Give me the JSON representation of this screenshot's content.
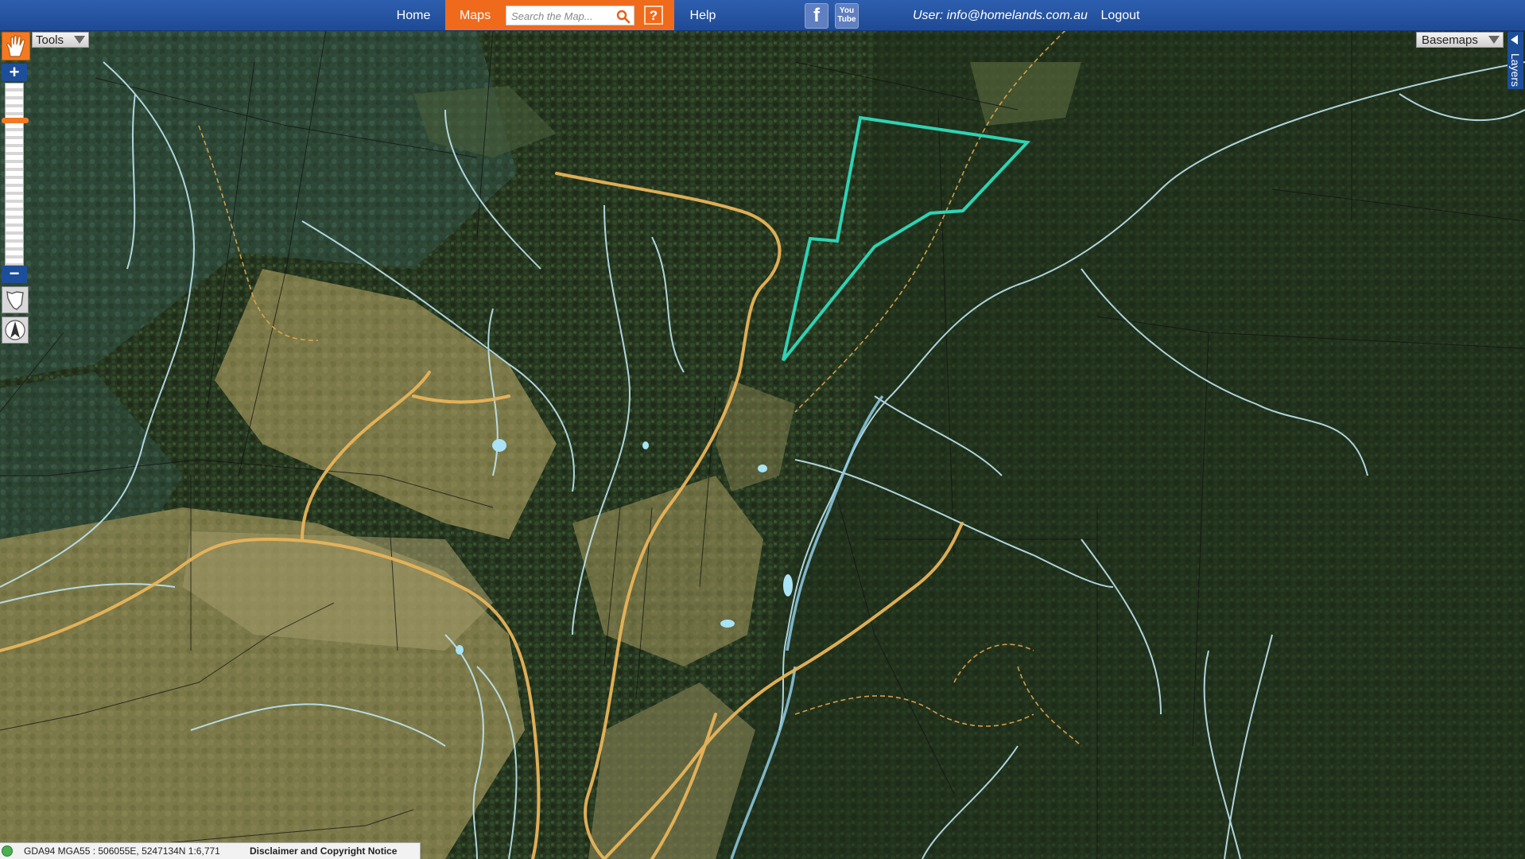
{
  "nav": {
    "home": "Home",
    "maps": "Maps",
    "search_placeholder": "Search the Map...",
    "help_icon": "?",
    "help": "Help",
    "user": "User: info@homelands.com.au",
    "logout": "Logout",
    "facebook_icon": "f",
    "youtube_icon": "You Tube"
  },
  "controls": {
    "tools": "Tools",
    "zoom_in": "+",
    "zoom_out": "−",
    "basemaps": "Basemaps",
    "layers": "Layers"
  },
  "status": {
    "coords": "GDA94 MGA55 : 506055E, 5247134N 1:6,771",
    "disclaimer": "Disclaimer and Copyright Notice"
  },
  "colors": {
    "nav_blue": "#2d5fb0",
    "maps_orange": "#f06a1c",
    "boundary": "#2ed3b4",
    "roads": "#e8b45a",
    "streams": "#bfe6f2"
  },
  "icons": [
    "pan-hand-icon",
    "search-icon",
    "facebook-icon",
    "youtube-icon",
    "tasmania-icon",
    "compass-icon"
  ]
}
